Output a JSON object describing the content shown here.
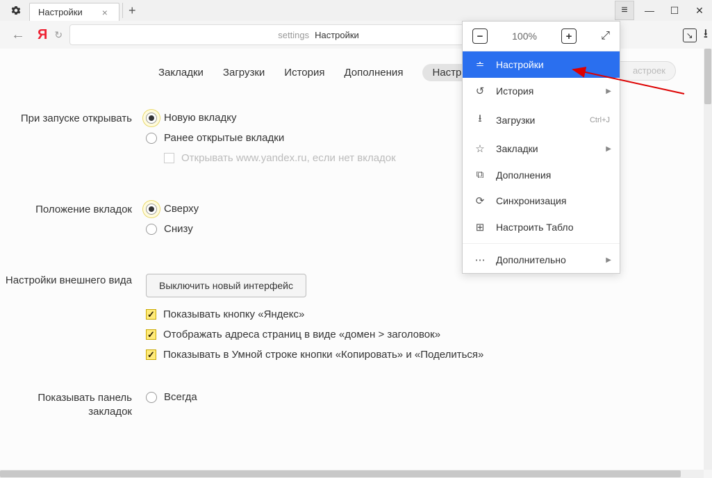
{
  "titlebar": {
    "tab_label": "Настройки"
  },
  "toolbar": {
    "url_prefix": "settings",
    "url_title": "Настройки"
  },
  "nav": {
    "bookmarks": "Закладки",
    "downloads": "Загрузки",
    "history": "История",
    "addons": "Дополнения",
    "settings": "Настройки",
    "search_placeholder": "астроек"
  },
  "sections": {
    "startup": {
      "label": "При запуске открывать",
      "opt_new_tab": "Новую вкладку",
      "opt_prev": "Ранее открытые вкладки",
      "opt_yandex": "Открывать www.yandex.ru, если нет вкладок"
    },
    "tab_position": {
      "label": "Положение вкладок",
      "opt_top": "Сверху",
      "opt_bottom": "Снизу"
    },
    "appearance": {
      "label": "Настройки внешнего вида",
      "btn": "Выключить новый интерфейс",
      "chk_yandex_button": "Показывать кнопку «Яндекс»",
      "chk_domain_title": "Отображать адреса страниц в виде «домен > заголовок»",
      "chk_smart_buttons": "Показывать в Умной строке кнопки «Копировать» и «Поделиться»"
    },
    "bookmarks_bar": {
      "label": "Показывать панель закладок",
      "opt_always": "Всегда"
    }
  },
  "menu": {
    "zoom": "100%",
    "settings": "Настройки",
    "history": "История",
    "downloads": "Загрузки",
    "downloads_shortcut": "Ctrl+J",
    "bookmarks": "Закладки",
    "addons": "Дополнения",
    "sync": "Синхронизация",
    "tableau": "Настроить Табло",
    "more": "Дополнительно"
  }
}
